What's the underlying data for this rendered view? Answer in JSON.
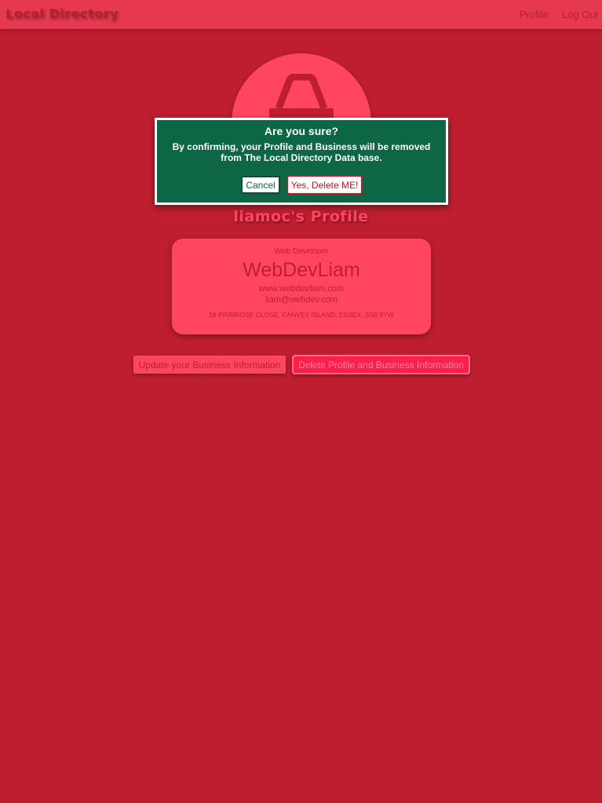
{
  "navbar": {
    "brand": "Local Directory",
    "links": {
      "profile": "Profile",
      "logout": "Log Out"
    }
  },
  "profile": {
    "avatar_icon": "shopping-basket-icon",
    "heading": "liamoc's Profile"
  },
  "business_card": {
    "job_title": "Web Developer",
    "business_name": "WebDevLiam",
    "website": "www.webdevliam.com",
    "email": "liam@webdev.com",
    "address": "18 PRIMROSE CLOSE, CANVEY ISLAND, ESSEX, SS8 9YW"
  },
  "actions": {
    "update_label": "Update your Business Information",
    "delete_label": "Delete Profile and Business Information"
  },
  "modal": {
    "title": "Are you sure?",
    "message": "By confirming, your Profile and Business will be removed from The Local Directory Data base.",
    "cancel_label": "Cancel",
    "confirm_label": "Yes, Delete ME!"
  },
  "colors": {
    "background": "#be1e2f",
    "navbar": "#e63950",
    "card": "#ff4560",
    "modal": "#0d6644",
    "danger": "#ff1f4b"
  }
}
